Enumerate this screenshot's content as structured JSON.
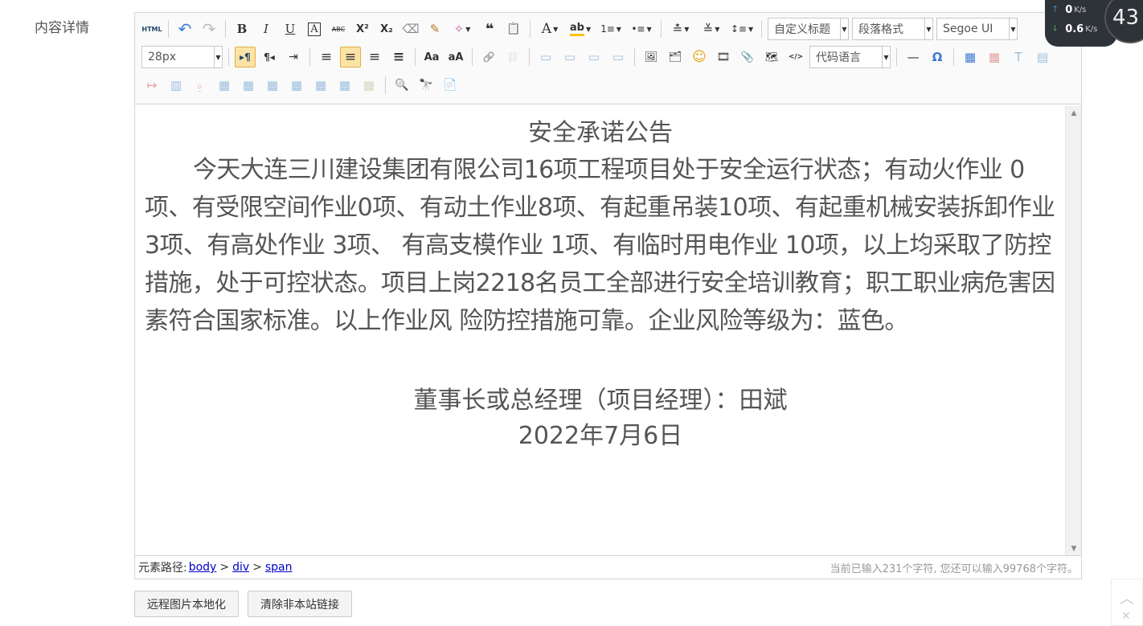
{
  "field": {
    "label": "内容详情"
  },
  "toolbar": {
    "row1": {
      "html": "HTML",
      "undo": "↶",
      "redo": "↷",
      "bold": "B",
      "italic": "I",
      "underline": "U",
      "fontborder": "A",
      "strike": "ABC",
      "sup": "X²",
      "sub": "X₂",
      "eraser": "⌫",
      "brush": "✎",
      "autotype": "✧",
      "quote": "❝",
      "paste": "📋",
      "forecolor": "A",
      "backcolor": "ab",
      "ol": "1≡",
      "ul": "•≡",
      "rowspace_top": "≛",
      "rowspace_bottom": "≚",
      "lineheight": "↕≡",
      "custom_style": "自定义标题",
      "paragraph": "段落格式",
      "font_family": "Segoe UI"
    },
    "row2": {
      "font_size": "28px",
      "ltr": "▸¶",
      "rtl": "¶◂",
      "indent": "⇥",
      "align_left": "≡",
      "align_center": "≡",
      "align_right": "≡",
      "align_justify": "≡",
      "touppercase": "Aa",
      "tolowercase": "aA",
      "link": "🔗",
      "unlink": "⛓",
      "img_none": "▭",
      "img_left": "▭",
      "img_right": "▭",
      "img_center": "▭",
      "image": "🖼",
      "multi_image": "🗂",
      "emotion": "☺",
      "video": "🎞",
      "attachment": "📎",
      "map": "🗺",
      "insert_code": "</>",
      "code_lang": "代码语言",
      "hr": "—",
      "special_char": "Ω",
      "table": "▦",
      "del_table": "▦",
      "caption": "T",
      "row_before": "▤"
    },
    "row3": {
      "row_after": "↦",
      "col_before": "▥",
      "col_after": "⍚",
      "merge_cells": "▦",
      "merge_right": "▦",
      "merge_down": "▦",
      "split_cells": "▦",
      "split_rows": "▦",
      "split_cols": "▦",
      "chart": "▦",
      "print": "🖨",
      "preview": "🔍",
      "search_replace": "🔭",
      "draft": "📄"
    }
  },
  "content": {
    "title": "安全承诺公告",
    "body": "今天大连三川建设集团有限公司16项工程项目处于安全运行状态；有动火作业 0项、有受限空间作业0项、有动土作业8项、有起重吊装10项、有起重机械安装拆卸作业3项、有高处作业 3项、 有高支模作业 1项、有临时用电作业 10项，以上均采取了防控措施，处于可控状态。项目上岗2218名员工全部进行安全培训教育；职工职业病危害因素符合国家标准。以上作业风 险防控措施可靠。企业风险等级为：蓝色。",
    "signature": "董事长或总经理（项目经理）：田斌",
    "date": "2022年7月6日"
  },
  "statusbar": {
    "path_label": "元素路径:",
    "path": [
      "body",
      "div",
      "span"
    ],
    "sep": ">",
    "count": "当前已输入231个字符, 您还可以输入99768个字符。"
  },
  "buttons": {
    "localize_images": "远程图片本地化",
    "clear_links": "清除非本站链接"
  },
  "net_widget": {
    "up_value": "0",
    "up_unit": "K/s",
    "down_value": "0.6",
    "down_unit": "K/s",
    "badge": "43"
  },
  "colors": {
    "active_btn": "#fbe3a6",
    "link": "#0000cc",
    "widget_bg": "#2e3239"
  }
}
